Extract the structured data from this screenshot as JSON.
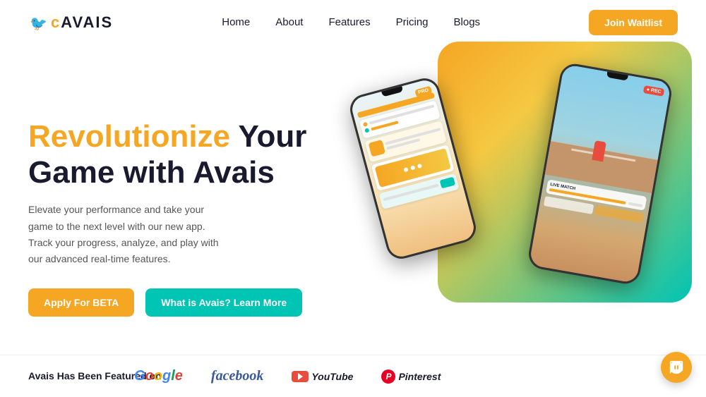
{
  "brand": {
    "logo_text": "AVAIS",
    "logo_prefix": "c"
  },
  "nav": {
    "links": [
      {
        "label": "Home",
        "id": "home"
      },
      {
        "label": "About",
        "id": "about"
      },
      {
        "label": "Features",
        "id": "features"
      },
      {
        "label": "Pricing",
        "id": "pricing"
      },
      {
        "label": "Blogs",
        "id": "blogs"
      }
    ],
    "cta": "Join Waitlist"
  },
  "hero": {
    "title_highlight": "Revolutionize",
    "title_rest": " Your Game with Avais",
    "description": "Elevate your performance and take your game to the next level with our new app. Track your progress, analyze, and play with our advanced real-time features.",
    "btn_beta": "Apply For BETA",
    "btn_learn": "What is Avais? Learn More"
  },
  "featured": {
    "label": "Avais Has Been Featured on",
    "brands": [
      "Google",
      "facebook",
      "YouTube",
      "Pinterest"
    ]
  },
  "colors": {
    "orange": "#f5a623",
    "teal": "#00c4b4",
    "dark": "#1a1a2e"
  }
}
